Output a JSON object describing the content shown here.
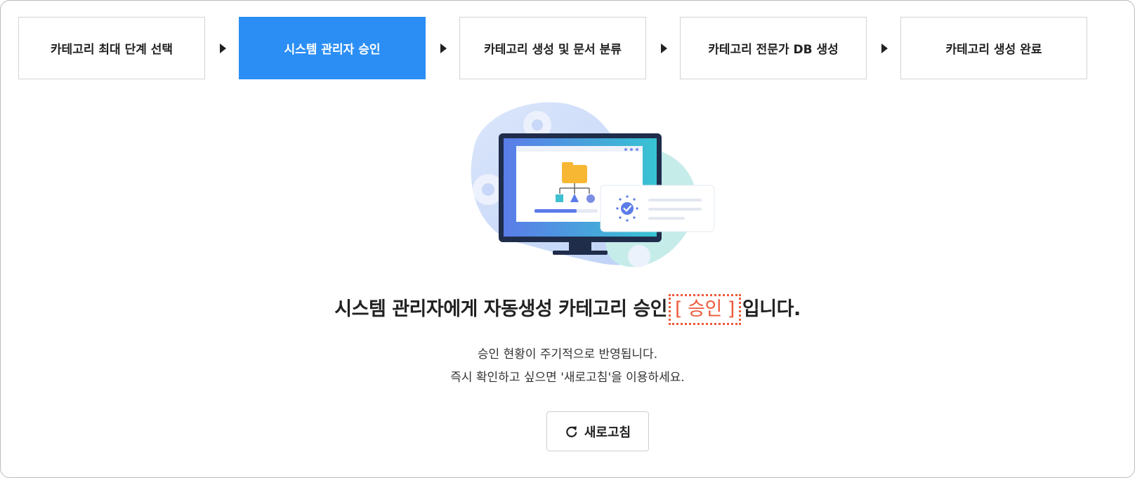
{
  "steps": [
    {
      "label": "카테고리 최대 단계 선택",
      "active": false
    },
    {
      "label": "시스템 관리자 승인",
      "active": true
    },
    {
      "label": "카테고리 생성 및 문서 분류",
      "active": false
    },
    {
      "label": "카테고리 전문가 DB 생성",
      "active": false
    },
    {
      "label": "카테고리 생성 완료",
      "active": false
    }
  ],
  "main": {
    "headline_before": "시스템 관리자에게 자동생성 카테고리 승인",
    "status_badge": "[ 승인 ]",
    "headline_after": "입니다.",
    "description_line1": "승인 현황이 주기적으로 반영됩니다.",
    "description_line2": "즉시 확인하고 싶으면 '새로고침'을 이용하세요.",
    "refresh_label": "새로고침"
  },
  "colors": {
    "accent": "#2b8ef5",
    "badge": "#ee5a3a"
  },
  "icons": {
    "step_arrow": "triangle-right-icon",
    "refresh": "refresh-icon"
  }
}
